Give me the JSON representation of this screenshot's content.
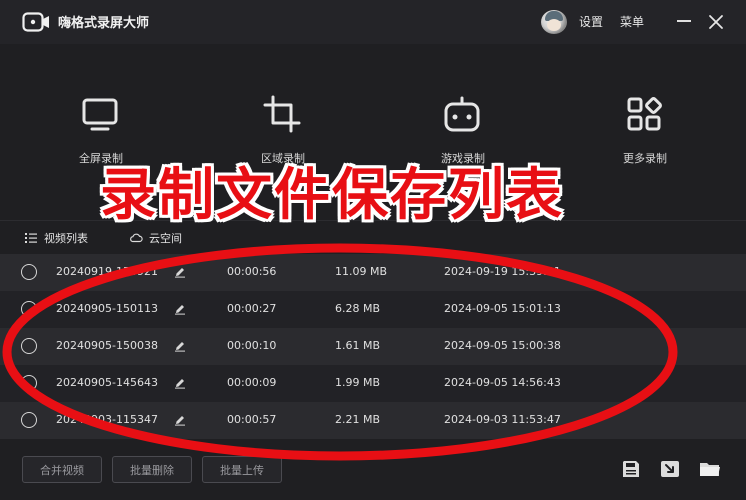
{
  "app": {
    "title": "嗨格式录屏大师",
    "accent": "#e80f14"
  },
  "titlebar": {
    "settings_label": "设置",
    "menu_label": "菜单"
  },
  "modes": [
    {
      "label": "全屏录制",
      "icon": "monitor-icon"
    },
    {
      "label": "区域录制",
      "icon": "crop-icon"
    },
    {
      "label": "游戏录制",
      "icon": "gamepad-icon"
    },
    {
      "label": "更多录制",
      "icon": "grid-icon"
    }
  ],
  "overlay": {
    "text": "录制文件保存列表",
    "color": "#e80f14"
  },
  "tabs": [
    {
      "label": "视频列表",
      "icon": "list-icon"
    },
    {
      "label": "云空间",
      "icon": "cloud-icon"
    }
  ],
  "files": [
    {
      "name": "20240919-153921",
      "duration": "00:00:56",
      "size": "11.09 MB",
      "date": "2024-09-19 15:39:21"
    },
    {
      "name": "20240905-150113",
      "duration": "00:00:27",
      "size": "6.28 MB",
      "date": "2024-09-05 15:01:13"
    },
    {
      "name": "20240905-150038",
      "duration": "00:00:10",
      "size": "1.61 MB",
      "date": "2024-09-05 15:00:38"
    },
    {
      "name": "20240905-145643",
      "duration": "00:00:09",
      "size": "1.99 MB",
      "date": "2024-09-05 14:56:43"
    },
    {
      "name": "20240903-115347",
      "duration": "00:00:57",
      "size": "2.21 MB",
      "date": "2024-09-03 11:53:47"
    }
  ],
  "footer": {
    "merge_label": "合并视频",
    "batch_delete_label": "批量删除",
    "batch_upload_label": "批量上传",
    "icons": [
      "save-icon",
      "import-icon",
      "folder-icon"
    ]
  }
}
